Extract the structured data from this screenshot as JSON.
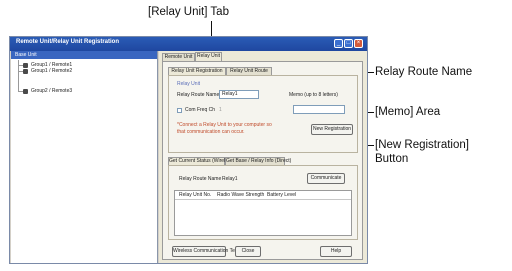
{
  "callouts": {
    "relay_unit_tab": "[Relay Unit] Tab",
    "relay_route_name": "Relay Route Name",
    "memo_area": "[Memo] Area",
    "new_registration_line1": "[New Registration]",
    "new_registration_line2": "Button"
  },
  "window": {
    "title": "Remote Unit/Relay Unit Registration",
    "controls": {
      "minimize": "_",
      "maximize": "□",
      "close": "×"
    }
  },
  "tree": {
    "header": "Base Unit",
    "items": [
      "Group1 / Remote1",
      "Group1 / Remote2",
      "Group2 / Remote3"
    ]
  },
  "tabs": [
    "Remote Unit",
    "Relay Unit"
  ],
  "subtabs": [
    "Relay Unit Registration",
    "Relay Unit Route"
  ],
  "registration": {
    "group_label": "Relay Unit",
    "route_name_label": "Relay Route Name",
    "route_name_value": "Relay1",
    "memo_label": "Memo (up to 8 letters)",
    "memo_value": "",
    "com_freq_label": "Com Freq Ch",
    "com_freq_value": "1",
    "notice_line1": "*Connect a Relay Unit to your computer so",
    "notice_line2": "that communication can occur.",
    "new_registration_button": "New Registration"
  },
  "status_tabs": [
    "Get Current Status (Wireless)",
    "Get Base / Relay Info (Direct)"
  ],
  "status": {
    "route_name_label": "Relay Route Name",
    "route_name_value": "Relay1",
    "communicate_button": "Communicate",
    "columns": [
      "Relay Unit No.",
      "Radio Wave Strength",
      "Battery Level"
    ]
  },
  "footer": {
    "wireless_test": "Wireless Communication Test",
    "close": "Close",
    "help": "Help"
  }
}
